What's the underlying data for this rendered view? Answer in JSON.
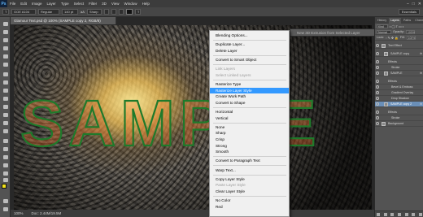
{
  "menubar": {
    "logo": "Ps",
    "items": [
      "File",
      "Edit",
      "Image",
      "Layer",
      "Type",
      "Select",
      "Filter",
      "3D",
      "View",
      "Window",
      "Help"
    ],
    "controls": [
      "–",
      "□",
      "✕"
    ]
  },
  "options": {
    "font_family": "GOE A104",
    "font_size": "140 pt",
    "font_style": "Regular",
    "aa_mode": "Sharp",
    "aa_label": "aA",
    "workspace": "Essentials"
  },
  "document": {
    "tab_title": "Glamour Text.psd @ 100% (SAMPLE copy 2, RGB/8)",
    "canvas_text": "SAMPLE",
    "status_zoom": "100%",
    "status_doc": "Doc: 2.44M/19.5M"
  },
  "context_menu": {
    "items": [
      {
        "label": "Blending Options...",
        "disabled": false
      },
      {
        "label": "Duplicate Layer...",
        "disabled": false
      },
      {
        "label": "Delete Layer",
        "disabled": false
      },
      {
        "label": "Convert to Smart Object",
        "disabled": false
      },
      {
        "label": "Link Layers",
        "disabled": true
      },
      {
        "label": "Select Linked Layers",
        "disabled": true
      },
      {
        "label": "Rasterize Type",
        "disabled": false
      },
      {
        "label": "Rasterize Layer Style",
        "disabled": false,
        "highlight": true
      },
      {
        "label": "Create Work Path",
        "disabled": false
      },
      {
        "label": "Convert to Shape",
        "disabled": false
      },
      {
        "label": "Horizontal",
        "disabled": false
      },
      {
        "label": "Vertical",
        "disabled": false
      },
      {
        "label": "None",
        "disabled": false
      },
      {
        "label": "Sharp",
        "disabled": false
      },
      {
        "label": "Crisp",
        "disabled": false
      },
      {
        "label": "Strong",
        "disabled": false
      },
      {
        "label": "Smooth",
        "disabled": false
      },
      {
        "label": "Convert to Paragraph Text",
        "disabled": false
      },
      {
        "label": "Warp Text...",
        "disabled": false
      },
      {
        "label": "Copy Layer Style",
        "disabled": false
      },
      {
        "label": "Paste Layer Style",
        "disabled": true
      },
      {
        "label": "Clear Layer Style",
        "disabled": false
      },
      {
        "label": "No Color",
        "disabled": false
      },
      {
        "label": "Red",
        "disabled": false
      }
    ]
  },
  "mini_panel": {
    "label": "New 3D Extrusion from Selected Layer"
  },
  "panel": {
    "tabs": [
      "History",
      "Layers",
      "Paths",
      "Channels"
    ],
    "active_tab": "Layers",
    "kind_label": "Kind",
    "blend_mode": "Normal",
    "opacity_label": "Opacity:",
    "opacity_value": "100%",
    "lock_label": "Lock:",
    "fill_label": "Fill:",
    "fill_value": "100%",
    "layers": [
      {
        "name": "Text Effect",
        "type": "group",
        "selected": false
      },
      {
        "name": "SAMPLE copy",
        "type": "text",
        "fx": true,
        "selected": false
      },
      {
        "name": "Effects",
        "type": "effects",
        "selected": false
      },
      {
        "name": "Stroke",
        "type": "effect",
        "selected": false
      },
      {
        "name": "SAMPLE",
        "type": "text",
        "fx": true,
        "selected": false
      },
      {
        "name": "Effects",
        "type": "effects",
        "selected": false
      },
      {
        "name": "Bevel & Emboss",
        "type": "effect",
        "selected": false
      },
      {
        "name": "Gradient Overlay",
        "type": "effect",
        "selected": false
      },
      {
        "name": "Drop Shadow",
        "type": "effect",
        "selected": false
      },
      {
        "name": "SAMPLE copy 2",
        "type": "text",
        "fx": true,
        "selected": true
      },
      {
        "name": "Effects",
        "type": "effects",
        "selected": false
      },
      {
        "name": "Stroke",
        "type": "effect",
        "selected": false
      },
      {
        "name": "Background",
        "type": "group",
        "selected": false
      }
    ]
  },
  "colors": {
    "foreground": "#f2e21a",
    "background": "#ffffff",
    "highlight": "#3399ff",
    "text_green": "#1f7a2b",
    "text_orange": "#e0611a"
  }
}
